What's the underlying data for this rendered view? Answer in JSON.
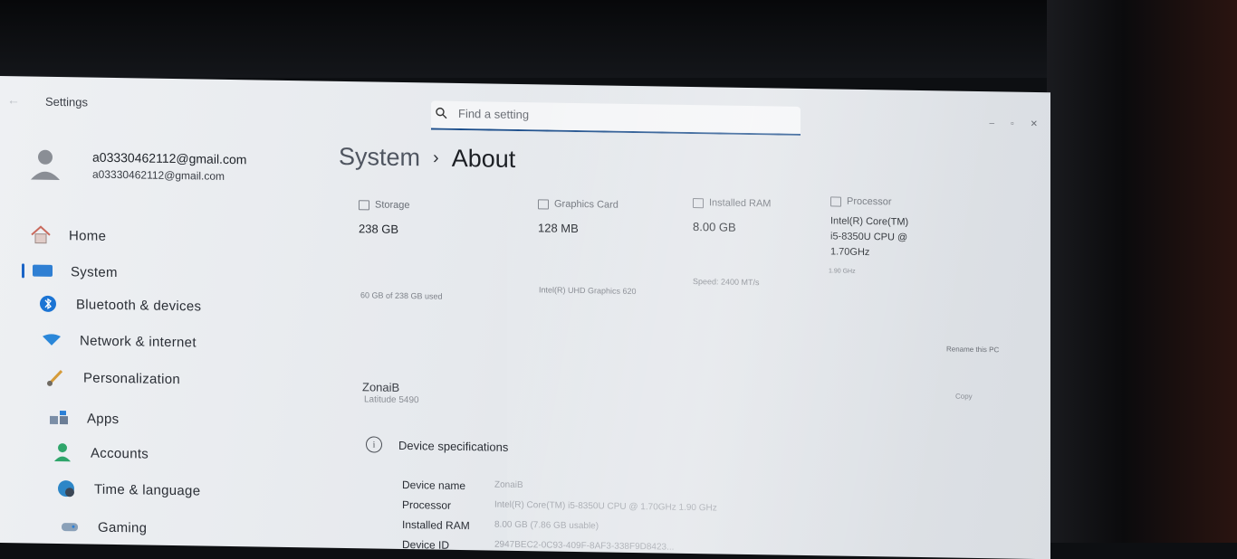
{
  "window": {
    "title": "Settings",
    "back_symbol": "←",
    "controls": [
      "–",
      "▫",
      "✕"
    ]
  },
  "search": {
    "placeholder": "Find a setting"
  },
  "profile": {
    "name": "a03330462112@gmail.com",
    "email": "a03330462112@gmail.com"
  },
  "nav": {
    "items": [
      {
        "label": "Home",
        "icon": "home-icon"
      },
      {
        "label": "System",
        "icon": "system-icon",
        "selected": true
      },
      {
        "label": "Bluetooth & devices",
        "icon": "bluetooth-icon"
      },
      {
        "label": "Network & internet",
        "icon": "wifi-icon"
      },
      {
        "label": "Personalization",
        "icon": "brush-icon"
      },
      {
        "label": "Apps",
        "icon": "apps-icon"
      },
      {
        "label": "Accounts",
        "icon": "accounts-icon"
      },
      {
        "label": "Time & language",
        "icon": "globe-clock-icon"
      },
      {
        "label": "Gaming",
        "icon": "gamepad-icon"
      }
    ]
  },
  "breadcrumb": {
    "parent": "System",
    "separator": "›",
    "current": "About"
  },
  "specs_summary": {
    "storage": {
      "label": "Storage",
      "value": "238 GB",
      "detail": "60 GB of 238 GB used"
    },
    "graphics": {
      "label": "Graphics Card",
      "value": "128 MB",
      "detail": "Intel(R) UHD Graphics 620"
    },
    "ram": {
      "label": "Installed RAM",
      "value": "8.00 GB",
      "detail": "Speed: 2400 MT/s"
    },
    "processor": {
      "label": "Processor",
      "value_lines": [
        "Intel(R) Core(TM)",
        "i5-8350U CPU @",
        "1.70GHz"
      ],
      "detail": "1.90 GHz"
    }
  },
  "device": {
    "name": "ZonaiB",
    "model": "Latitude 5490",
    "rename_label": "Rename this PC",
    "copy_label": "Copy"
  },
  "device_specs": {
    "title": "Device specifications",
    "info_symbol": "i",
    "rows": [
      {
        "key": "Device name",
        "value": "ZonaiB"
      },
      {
        "key": "Processor",
        "value": "Intel(R) Core(TM) i5-8350U CPU @ 1.70GHz 1.90 GHz"
      },
      {
        "key": "Installed RAM",
        "value": "8.00 GB (7.86 GB usable)"
      },
      {
        "key": "Device ID",
        "value": "2947BEC2-0C93-409F-8AF3-338F9D8423..."
      }
    ]
  },
  "colors": {
    "accent": "#1b64c6",
    "window_bg": "#e6e9ed",
    "text": "#1f2329"
  }
}
